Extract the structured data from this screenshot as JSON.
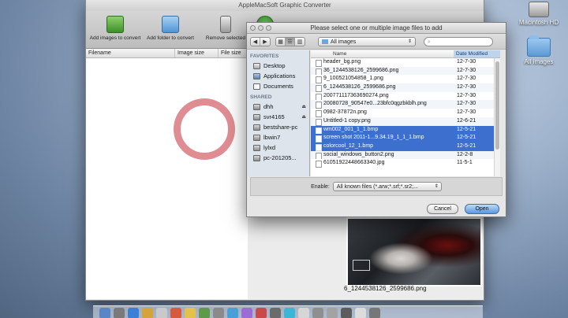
{
  "desktop": {
    "hd_label": "Macintosh HD",
    "folder_label": "All images"
  },
  "app": {
    "title": "AppleMacSoft Graphic Converter",
    "toolbar": {
      "add_images": "Add images to convert",
      "add_folder": "Add folder to convert",
      "remove_selected": "Remove selected",
      "convert": "Co"
    },
    "columns": {
      "filename": "Filename",
      "image_size": "Image size",
      "file_size": "File size"
    },
    "preview_caption": "6_1244538126_2599686.png"
  },
  "dialog": {
    "title": "Please select one or multiple image files to add",
    "location": "All images",
    "sidebar": {
      "favorites_header": "FAVORITES",
      "favorites": [
        "Desktop",
        "Applications",
        "Documents"
      ],
      "shared_header": "SHARED",
      "shared": [
        "dhh",
        "svr4165",
        "bestshare-pc",
        "lbwin7",
        "lylxd",
        "pc-201205..."
      ]
    },
    "columns": {
      "name": "Name",
      "date": "Date Modified"
    },
    "files": [
      {
        "name": "header_bg.png",
        "date": "12-7-30"
      },
      {
        "name": "36_1244538126_2599686.png",
        "date": "12-7-30"
      },
      {
        "name": "9_100521054858_1.png",
        "date": "12-7-30"
      },
      {
        "name": "6_1244538126_2599686.png",
        "date": "12-7-30"
      },
      {
        "name": "2007711173636902​74.png",
        "date": "12-7-30"
      },
      {
        "name": "20080728_90547e0...23bfc0qgzbkblh.png",
        "date": "12-7-30"
      },
      {
        "name": "0982-37872n.png",
        "date": "12-7-30"
      },
      {
        "name": "Untitled-1 copy.png",
        "date": "12-6-21"
      },
      {
        "name": "wm002_001_1_1.bmp",
        "date": "12-5-21"
      },
      {
        "name": "screen shot 2011-1...9.34.19_1_1_1.bmp",
        "date": "12-5-21"
      },
      {
        "name": "colorcool_12_1.bmp",
        "date": "12-5-21"
      },
      {
        "name": "social_windows_button2.png",
        "date": "12-2-8"
      },
      {
        "name": "610519224486633​40.jpg",
        "date": "11-5-1"
      }
    ],
    "enable_label": "Enable:",
    "enable_value": "All known files (*.arw;*.srf;*.sr2;...",
    "cancel": "Cancel",
    "open": "Open"
  }
}
